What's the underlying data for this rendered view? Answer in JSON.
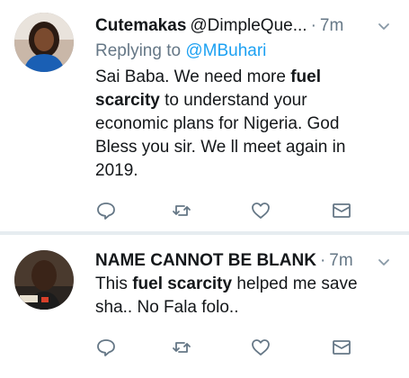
{
  "tweets": [
    {
      "display_name": "Cutemakas",
      "handle": "@DimpleQue...",
      "separator": "·",
      "time": "7m",
      "replying_prefix": "Replying to",
      "replying_to": "@MBuhari",
      "text_parts": [
        "Sai Baba. We need more ",
        "fuel scarcity",
        " to understand your economic plans for Nigeria. God Bless you sir. We ll meet again in 2019."
      ]
    },
    {
      "display_name": "NAME CANNOT BE BLANK",
      "separator": "·",
      "time": "7m",
      "text_parts": [
        "This ",
        "fuel scarcity",
        " helped me save sha.. No Fala folo.."
      ],
      "avatar_badge": "FALEX"
    }
  ],
  "icons": {
    "reply": "reply-icon",
    "retweet": "retweet-icon",
    "like": "heart-icon",
    "dm": "envelope-icon",
    "menu": "chevron-down-icon"
  },
  "colors": {
    "text": "#14171a",
    "muted": "#657786",
    "link": "#1da1f2",
    "divider": "#e6ecf0"
  }
}
